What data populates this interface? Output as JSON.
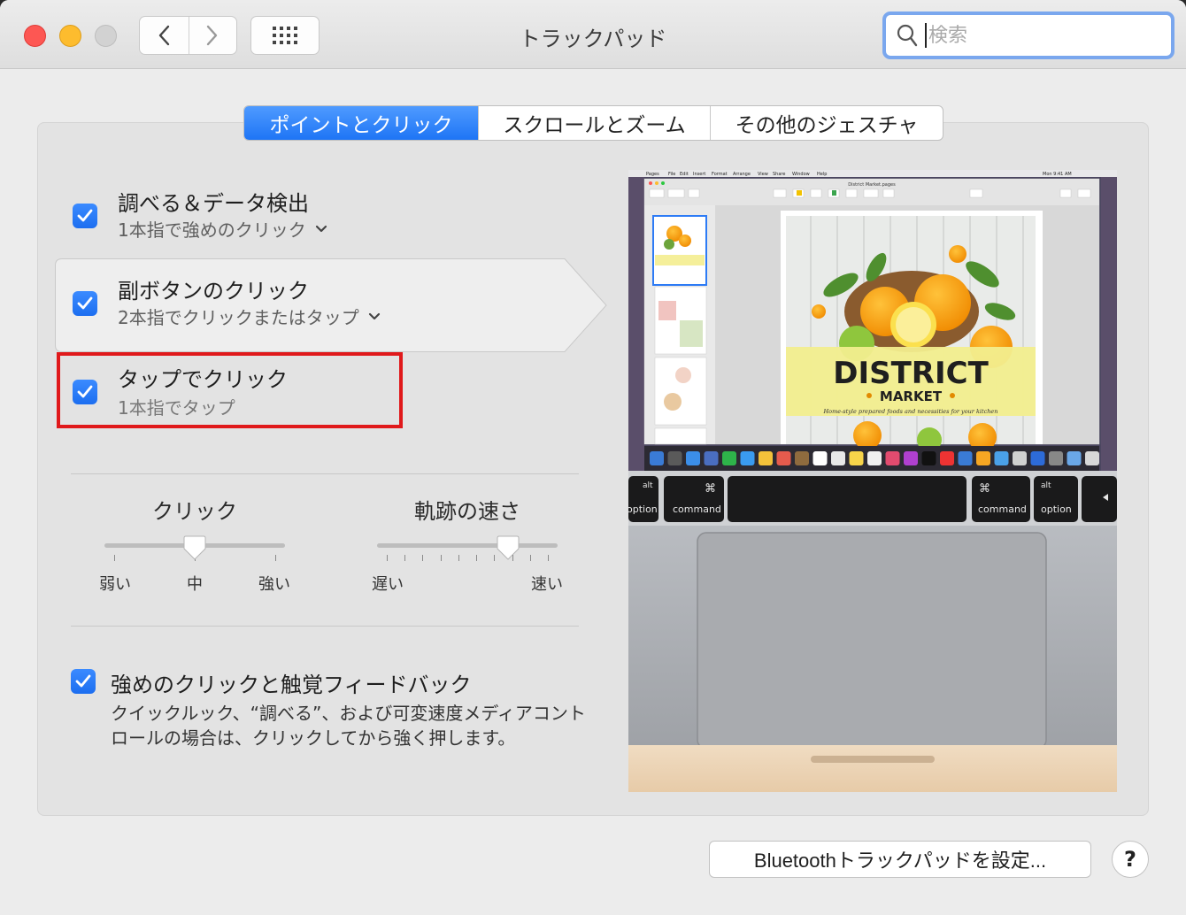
{
  "window": {
    "title": "トラックパッド"
  },
  "search": {
    "placeholder": "検索"
  },
  "tabs": [
    {
      "label": "ポイントとクリック",
      "active": true
    },
    {
      "label": "スクロールとズーム",
      "active": false
    },
    {
      "label": "その他のジェスチャ",
      "active": false
    }
  ],
  "options": [
    {
      "title": "調べる＆データ検出",
      "subtitle": "1本指で強めのクリック",
      "checked": true,
      "has_dropdown": true
    },
    {
      "title": "副ボタンのクリック",
      "subtitle": "2本指でクリックまたはタップ",
      "checked": true,
      "has_dropdown": true,
      "selected": true
    },
    {
      "title": "タップでクリック",
      "subtitle": "1本指でタップ",
      "checked": true,
      "has_dropdown": false,
      "highlighted": true
    }
  ],
  "sliders": {
    "click": {
      "label": "クリック",
      "min_label": "弱い",
      "mid_label": "中",
      "max_label": "強い",
      "value_fraction": 0.5
    },
    "tracking": {
      "label": "軌跡の速さ",
      "min_label": "遅い",
      "max_label": "速い",
      "value_fraction": 0.75
    }
  },
  "force_click": {
    "title": "強めのクリックと触覚フィードバック",
    "description": "クイックルック、“調べる”、および可変速度メディアコントロールの場合は、クリックしてから強く押します。",
    "checked": true
  },
  "preview": {
    "doc_title": "District Market.pages",
    "menu": [
      "Pages",
      "File",
      "Edit",
      "Insert",
      "Format",
      "Arrange",
      "View",
      "Share",
      "Window",
      "Help"
    ],
    "clock": "Mon 9:41 AM",
    "cover_title": "DISTRICT",
    "cover_subtitle": "MARKET",
    "cover_tagline": "Home-style prepared foods and necessities for your kitchen",
    "keys": {
      "alt_left": "alt",
      "option_left": "option",
      "cmd_symbol": "⌘",
      "command": "command",
      "alt_right": "alt",
      "option_right": "option"
    }
  },
  "buttons": {
    "bluetooth": "Bluetoothトラックパッドを設定...",
    "help": "?"
  },
  "colors": {
    "accent": "#1c6ef0",
    "highlight_border": "#e0191b"
  }
}
